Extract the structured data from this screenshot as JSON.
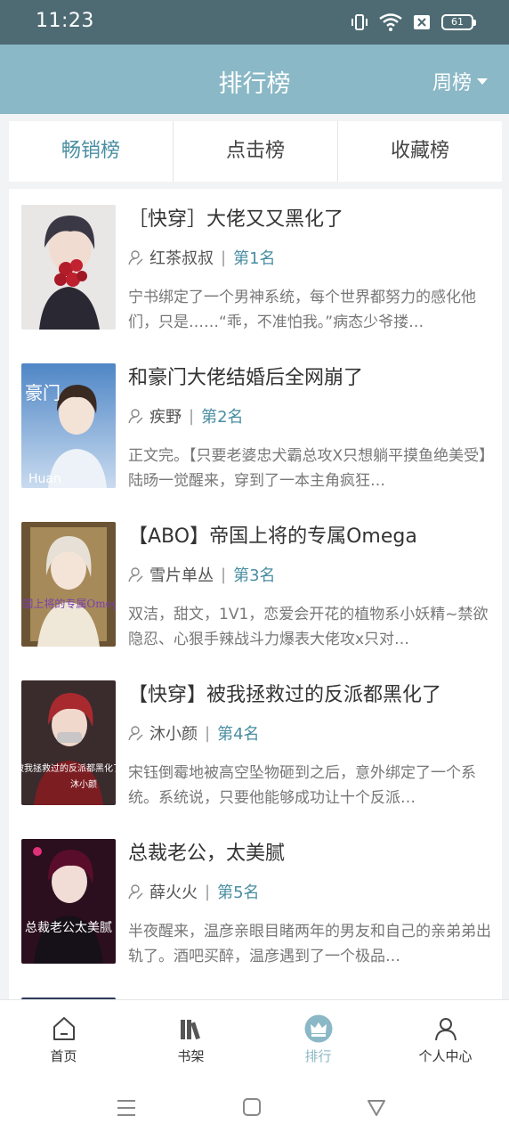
{
  "status_bar": {
    "time": "11:23",
    "battery": "61"
  },
  "header": {
    "title": "排行榜",
    "period": "周榜"
  },
  "tabs": [
    {
      "label": "畅销榜",
      "active": true
    },
    {
      "label": "点击榜",
      "active": false
    },
    {
      "label": "收藏榜",
      "active": false
    }
  ],
  "books": [
    {
      "title": "［快穿］大佬又又黑化了",
      "author": "红茶叔叔",
      "rank": "第1名",
      "description": "宁书绑定了一个男神系统，每个世界都努力的感化他们，只是……“乖，不准怕我。”病态少爷搂…"
    },
    {
      "title": "和豪门大佬结婚后全网崩了",
      "author": "疾野",
      "rank": "第2名",
      "description": "正文完。【只要老婆忠犬霸总攻X只想躺平摸鱼绝美受】陆旸一觉醒来，穿到了一本主角疯狂…"
    },
    {
      "title": "【ABO】帝国上将的专属Omega",
      "author": "雪片单丛",
      "rank": "第3名",
      "description": "双洁，甜文，1V1，恋爱会开花的植物系小妖精~禁欲隐忍、心狠手辣战斗力爆表大佬攻x只对…"
    },
    {
      "title": "【快穿】被我拯救过的反派都黑化了",
      "author": "沐小颜",
      "rank": "第4名",
      "description": "宋钰倒霉地被高空坠物砸到之后，意外绑定了一个系统。系统说，只要他能够成功让十个反派…"
    },
    {
      "title": "总裁老公，太美腻",
      "author": "薛火火",
      "rank": "第5名",
      "description": "半夜醒来，温彦亲眼目睹两年的男友和自己的亲弟弟出轨了。酒吧买醉，温彦遇到了一个极品…"
    }
  ],
  "covers": [
    {
      "text": "",
      "sub": ""
    },
    {
      "text": "豪门",
      "sub": "Huan"
    },
    {
      "text": "帝国上将的专属Omega",
      "sub": ""
    },
    {
      "text": "被我拯救过的反派都黑化了",
      "sub": "沐小颜"
    },
    {
      "text": "总裁老公太美腻",
      "sub": ""
    }
  ],
  "bottom_nav": [
    {
      "label": "首页",
      "icon": "home-icon",
      "active": false
    },
    {
      "label": "书架",
      "icon": "bookshelf-icon",
      "active": false
    },
    {
      "label": "排行",
      "icon": "crown-icon",
      "active": true
    },
    {
      "label": "个人中心",
      "icon": "user-icon",
      "active": false
    }
  ],
  "colors": {
    "header": "#8ab8c6",
    "accent": "#4a8ea2",
    "status_bar": "#4e6b74"
  }
}
